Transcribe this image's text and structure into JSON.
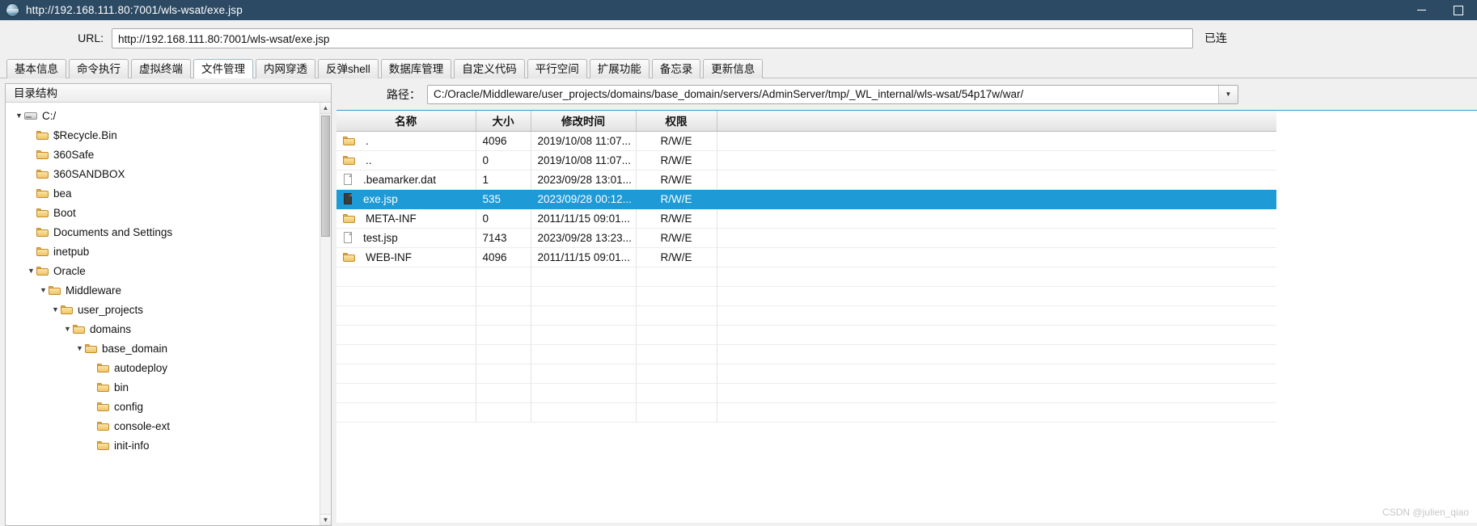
{
  "window": {
    "title": "http://192.168.111.80:7001/wls-wsat/exe.jsp",
    "icon": "globe-icon",
    "minimize": "–",
    "maximize": "□"
  },
  "url_bar": {
    "label": "URL:",
    "value": "http://192.168.111.80:7001/wls-wsat/exe.jsp",
    "trailing": "已连"
  },
  "tabs": [
    {
      "label": "基本信息",
      "active": false
    },
    {
      "label": "命令执行",
      "active": false
    },
    {
      "label": "虚拟终端",
      "active": false
    },
    {
      "label": "文件管理",
      "active": true
    },
    {
      "label": "内网穿透",
      "active": false
    },
    {
      "label": "反弹shell",
      "active": false
    },
    {
      "label": "数据库管理",
      "active": false
    },
    {
      "label": "自定义代码",
      "active": false
    },
    {
      "label": "平行空间",
      "active": false
    },
    {
      "label": "扩展功能",
      "active": false
    },
    {
      "label": "备忘录",
      "active": false
    },
    {
      "label": "更新信息",
      "active": false
    }
  ],
  "sidebar": {
    "header": "目录结构",
    "nodes": [
      {
        "label": "C:/",
        "depth": 0,
        "icon": "drive-icon",
        "twisty": "▼"
      },
      {
        "label": "$Recycle.Bin",
        "depth": 1,
        "icon": "folder-icon",
        "twisty": ""
      },
      {
        "label": "360Safe",
        "depth": 1,
        "icon": "folder-icon",
        "twisty": ""
      },
      {
        "label": "360SANDBOX",
        "depth": 1,
        "icon": "folder-icon",
        "twisty": ""
      },
      {
        "label": "bea",
        "depth": 1,
        "icon": "folder-icon",
        "twisty": ""
      },
      {
        "label": "Boot",
        "depth": 1,
        "icon": "folder-icon",
        "twisty": ""
      },
      {
        "label": "Documents and Settings",
        "depth": 1,
        "icon": "folder-icon",
        "twisty": ""
      },
      {
        "label": "inetpub",
        "depth": 1,
        "icon": "folder-icon",
        "twisty": ""
      },
      {
        "label": "Oracle",
        "depth": 1,
        "icon": "folder-icon",
        "twisty": "▼"
      },
      {
        "label": "Middleware",
        "depth": 2,
        "icon": "folder-icon",
        "twisty": "▼"
      },
      {
        "label": "user_projects",
        "depth": 3,
        "icon": "folder-icon",
        "twisty": "▼"
      },
      {
        "label": "domains",
        "depth": 4,
        "icon": "folder-icon",
        "twisty": "▼"
      },
      {
        "label": "base_domain",
        "depth": 5,
        "icon": "folder-icon",
        "twisty": "▼"
      },
      {
        "label": "autodeploy",
        "depth": 6,
        "icon": "folder-icon",
        "twisty": ""
      },
      {
        "label": "bin",
        "depth": 6,
        "icon": "folder-icon",
        "twisty": ""
      },
      {
        "label": "config",
        "depth": 6,
        "icon": "folder-icon",
        "twisty": ""
      },
      {
        "label": "console-ext",
        "depth": 6,
        "icon": "folder-icon",
        "twisty": ""
      },
      {
        "label": "init-info",
        "depth": 6,
        "icon": "folder-icon",
        "twisty": ""
      }
    ]
  },
  "path_bar": {
    "label": "路径：",
    "value": "C:/Oracle/Middleware/user_projects/domains/base_domain/servers/AdminServer/tmp/_WL_internal/wls-wsat/54p17w/war/",
    "dropdown_icon": "chevron-down-icon"
  },
  "file_table": {
    "columns": [
      "名称",
      "大小",
      "修改时间",
      "权限"
    ],
    "rows": [
      {
        "icon": "folder-icon",
        "name": ".",
        "size": "4096",
        "mtime": "2019/10/08 11:07...",
        "perm": "R/W/E",
        "selected": false
      },
      {
        "icon": "folder-icon",
        "name": "..",
        "size": "0",
        "mtime": "2019/10/08 11:07...",
        "perm": "R/W/E",
        "selected": false
      },
      {
        "icon": "file-icon",
        "name": ".beamarker.dat",
        "size": "1",
        "mtime": "2023/09/28 13:01...",
        "perm": "R/W/E",
        "selected": false
      },
      {
        "icon": "file-icon",
        "name": "exe.jsp",
        "size": "535",
        "mtime": "2023/09/28 00:12...",
        "perm": "R/W/E",
        "selected": true
      },
      {
        "icon": "folder-icon",
        "name": "META-INF",
        "size": "0",
        "mtime": "2011/11/15 09:01...",
        "perm": "R/W/E",
        "selected": false
      },
      {
        "icon": "file-icon",
        "name": "test.jsp",
        "size": "7143",
        "mtime": "2023/09/28 13:23...",
        "perm": "R/W/E",
        "selected": false
      },
      {
        "icon": "folder-icon",
        "name": "WEB-INF",
        "size": "4096",
        "mtime": "2011/11/15 09:01...",
        "perm": "R/W/E",
        "selected": false
      }
    ],
    "empty_row_count": 8
  },
  "watermark": "CSDN @julien_qiao",
  "colors": {
    "titlebar": "#2c4a63",
    "selection": "#1e9ad6",
    "table_top_border": "#2f9fd0",
    "folder": "#f0c668"
  }
}
